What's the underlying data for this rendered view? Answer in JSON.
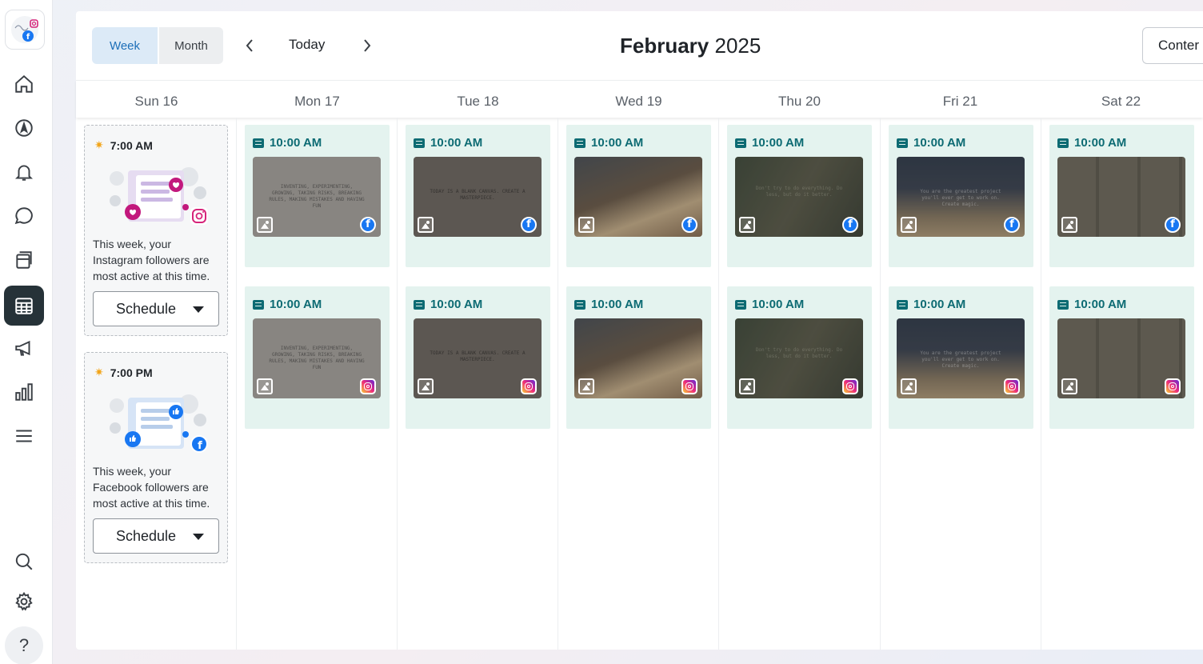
{
  "app": {
    "nav": [
      "home-icon",
      "compass-icon",
      "bell-icon",
      "chat-icon",
      "layers-icon",
      "calendar-icon",
      "megaphone-icon",
      "bar-chart-icon",
      "menu-icon"
    ],
    "bottom_nav": [
      "search-icon",
      "gear-icon",
      "help-icon"
    ],
    "help_label": "?"
  },
  "toolbar": {
    "view_week": "Week",
    "view_month": "Month",
    "selected_view": "Week",
    "today_label": "Today",
    "month_bold": "February",
    "year": "2025",
    "content_button": "Conter"
  },
  "days": [
    "Sun 16",
    "Mon 17",
    "Tue 18",
    "Wed 19",
    "Thu 20",
    "Fri 21",
    "Sat 22"
  ],
  "suggestions": [
    {
      "time": "7:00 AM",
      "network": "instagram",
      "text": "This week, your Instagram followers are most active at this time.",
      "button": "Schedule"
    },
    {
      "time": "7:00 PM",
      "network": "facebook",
      "text": "This week, your Facebook followers are most active at this time.",
      "button": "Schedule"
    }
  ],
  "posts": {
    "time": "10:00 AM",
    "rows": [
      {
        "network": "facebook"
      },
      {
        "network": "instagram"
      }
    ],
    "thumbs": [
      {
        "day": "Mon 17",
        "theme": "light-quote",
        "caption": "Inventing, experimenting, growing, taking risks, breaking rules, making mistakes and having fun"
      },
      {
        "day": "Tue 18",
        "theme": "dark-quote",
        "caption": "Today is a blank canvas. Create a masterpiece."
      },
      {
        "day": "Wed 19",
        "theme": "painting",
        "caption": ""
      },
      {
        "day": "Thu 20",
        "theme": "leaves",
        "caption": "Don't try to do everything. Do less, but do it better."
      },
      {
        "day": "Fri 21",
        "theme": "crafting",
        "caption": "You are the greatest project you'll ever get to work on. Create magic."
      },
      {
        "day": "Sat 22",
        "theme": "sticky-notes",
        "caption": ""
      }
    ]
  },
  "colors": {
    "accent": "#1d6fb8",
    "post_bg": "#e4f3ef",
    "post_time": "#0d6b73",
    "facebook": "#1877f2",
    "sidebar_active": "#263238"
  }
}
